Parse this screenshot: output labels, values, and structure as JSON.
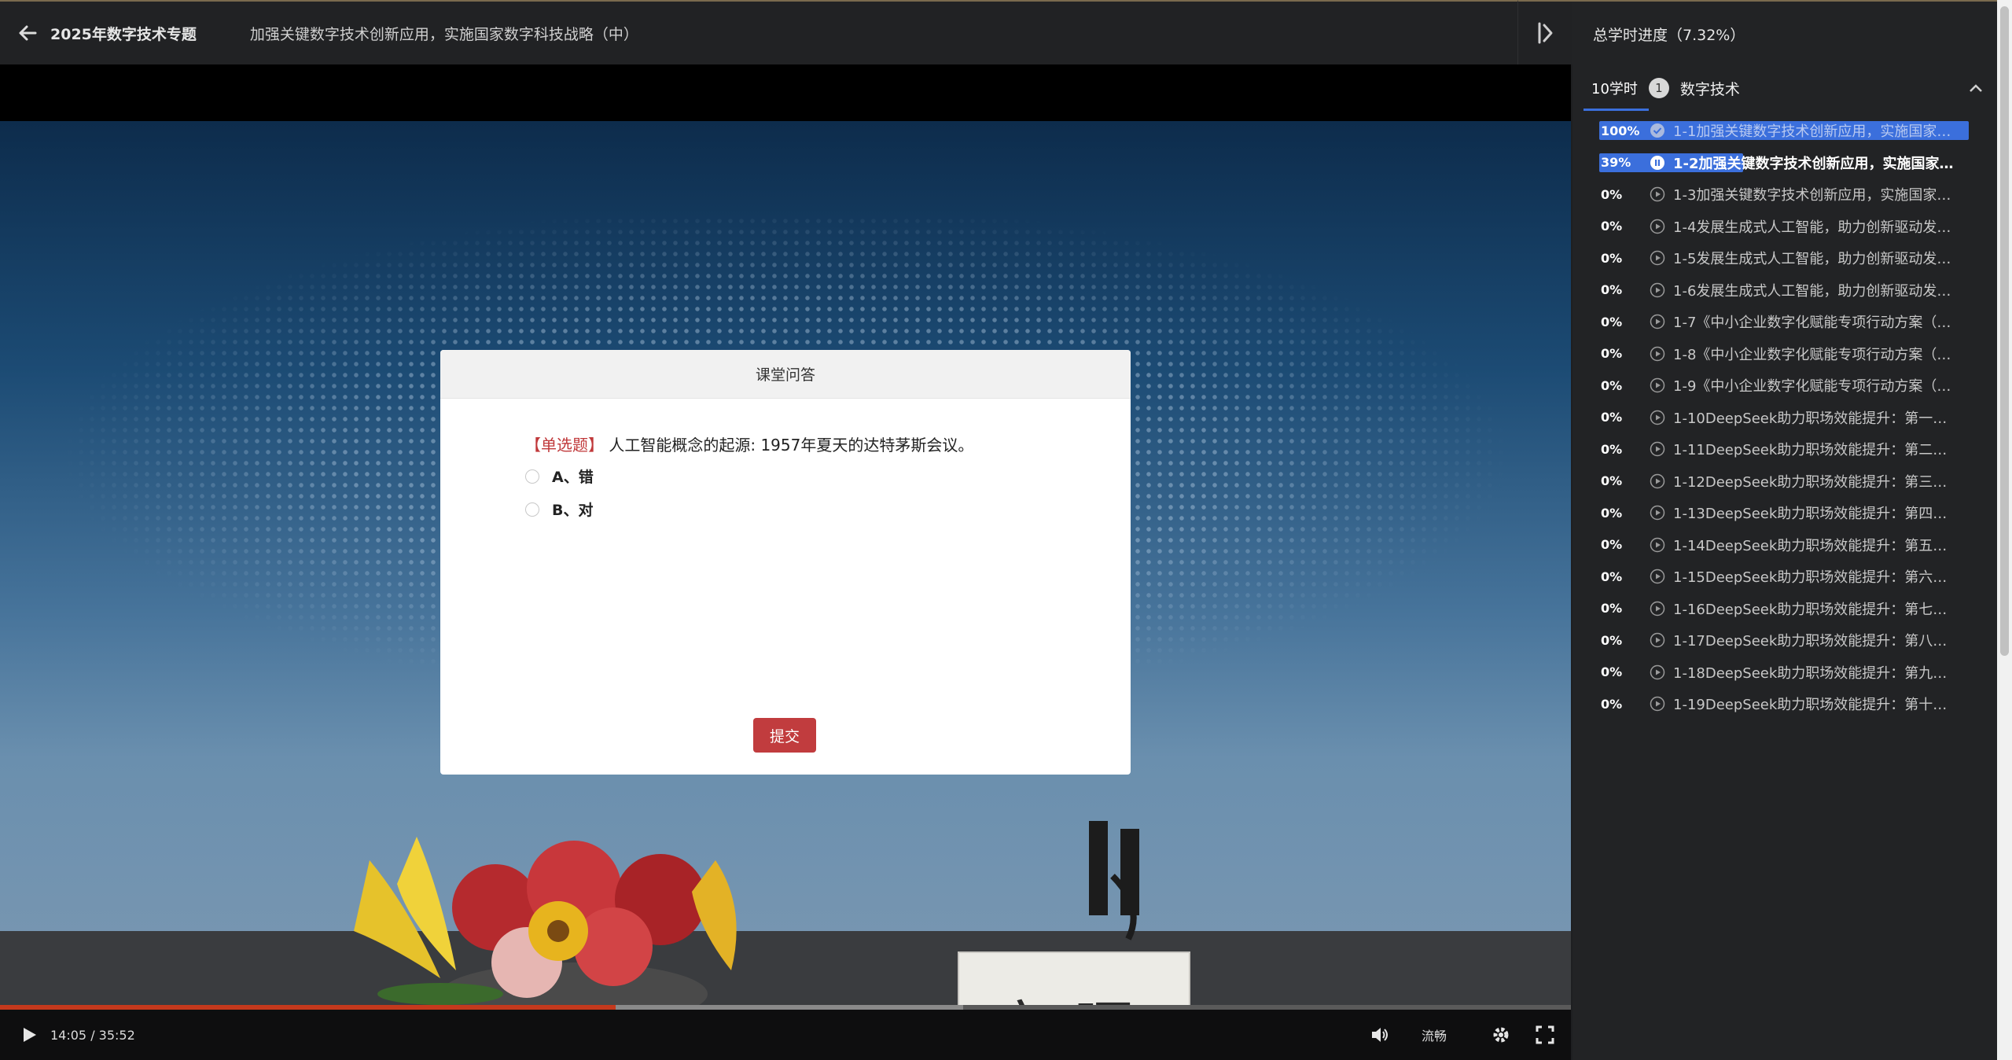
{
  "header": {
    "special_title": "2025年数字技术专题",
    "course_title": "加强关键数字技术创新应用，实施国家数字科技战略（中）"
  },
  "panel": {
    "progress_label": "总学时进度（7.32%）",
    "chapter": {
      "hours": "10学时",
      "number": "1",
      "name": "数字技术"
    },
    "lessons": [
      {
        "pct": "100%",
        "progress": 1.0,
        "title": "1-1加强关键数字技术创新应用，实施国家…",
        "state": "done"
      },
      {
        "pct": "39%",
        "progress": 0.39,
        "title": "1-2加强关键数字技术创新应用，实施国家…",
        "state": "active"
      },
      {
        "pct": "0%",
        "progress": 0,
        "title": "1-3加强关键数字技术创新应用，实施国家…",
        "state": "todo"
      },
      {
        "pct": "0%",
        "progress": 0,
        "title": "1-4发展生成式人工智能，助力创新驱动发…",
        "state": "todo"
      },
      {
        "pct": "0%",
        "progress": 0,
        "title": "1-5发展生成式人工智能，助力创新驱动发…",
        "state": "todo"
      },
      {
        "pct": "0%",
        "progress": 0,
        "title": "1-6发展生成式人工智能，助力创新驱动发…",
        "state": "todo"
      },
      {
        "pct": "0%",
        "progress": 0,
        "title": "1-7《中小企业数字化赋能专项行动方案（…",
        "state": "todo"
      },
      {
        "pct": "0%",
        "progress": 0,
        "title": "1-8《中小企业数字化赋能专项行动方案（…",
        "state": "todo"
      },
      {
        "pct": "0%",
        "progress": 0,
        "title": "1-9《中小企业数字化赋能专项行动方案（…",
        "state": "todo"
      },
      {
        "pct": "0%",
        "progress": 0,
        "title": "1-10DeepSeek助力职场效能提升：第一…",
        "state": "todo"
      },
      {
        "pct": "0%",
        "progress": 0,
        "title": "1-11DeepSeek助力职场效能提升：第二…",
        "state": "todo"
      },
      {
        "pct": "0%",
        "progress": 0,
        "title": "1-12DeepSeek助力职场效能提升：第三…",
        "state": "todo"
      },
      {
        "pct": "0%",
        "progress": 0,
        "title": "1-13DeepSeek助力职场效能提升：第四…",
        "state": "todo"
      },
      {
        "pct": "0%",
        "progress": 0,
        "title": "1-14DeepSeek助力职场效能提升：第五…",
        "state": "todo"
      },
      {
        "pct": "0%",
        "progress": 0,
        "title": "1-15DeepSeek助力职场效能提升：第六…",
        "state": "todo"
      },
      {
        "pct": "0%",
        "progress": 0,
        "title": "1-16DeepSeek助力职场效能提升：第七…",
        "state": "todo"
      },
      {
        "pct": "0%",
        "progress": 0,
        "title": "1-17DeepSeek助力职场效能提升：第八…",
        "state": "todo"
      },
      {
        "pct": "0%",
        "progress": 0,
        "title": "1-18DeepSeek助力职场效能提升：第九…",
        "state": "todo"
      },
      {
        "pct": "0%",
        "progress": 0,
        "title": "1-19DeepSeek助力职场效能提升：第十…",
        "state": "todo"
      }
    ]
  },
  "video": {
    "time": "14:05 / 35:52",
    "played_fraction": 0.392,
    "buffered_fraction": 0.613,
    "quality": "流畅",
    "name_card": "安晖"
  },
  "quiz": {
    "title": "课堂问答",
    "type_label": "【单选题】",
    "question": "人工智能概念的起源: 1957年夏天的达特茅斯会议。",
    "options": [
      "A、错",
      "B、对"
    ],
    "submit_label": "提交"
  },
  "colors": {
    "accent_blue": "#3b6fdc",
    "submit_red": "#c13c3e",
    "progress_red": "#c4391d"
  }
}
